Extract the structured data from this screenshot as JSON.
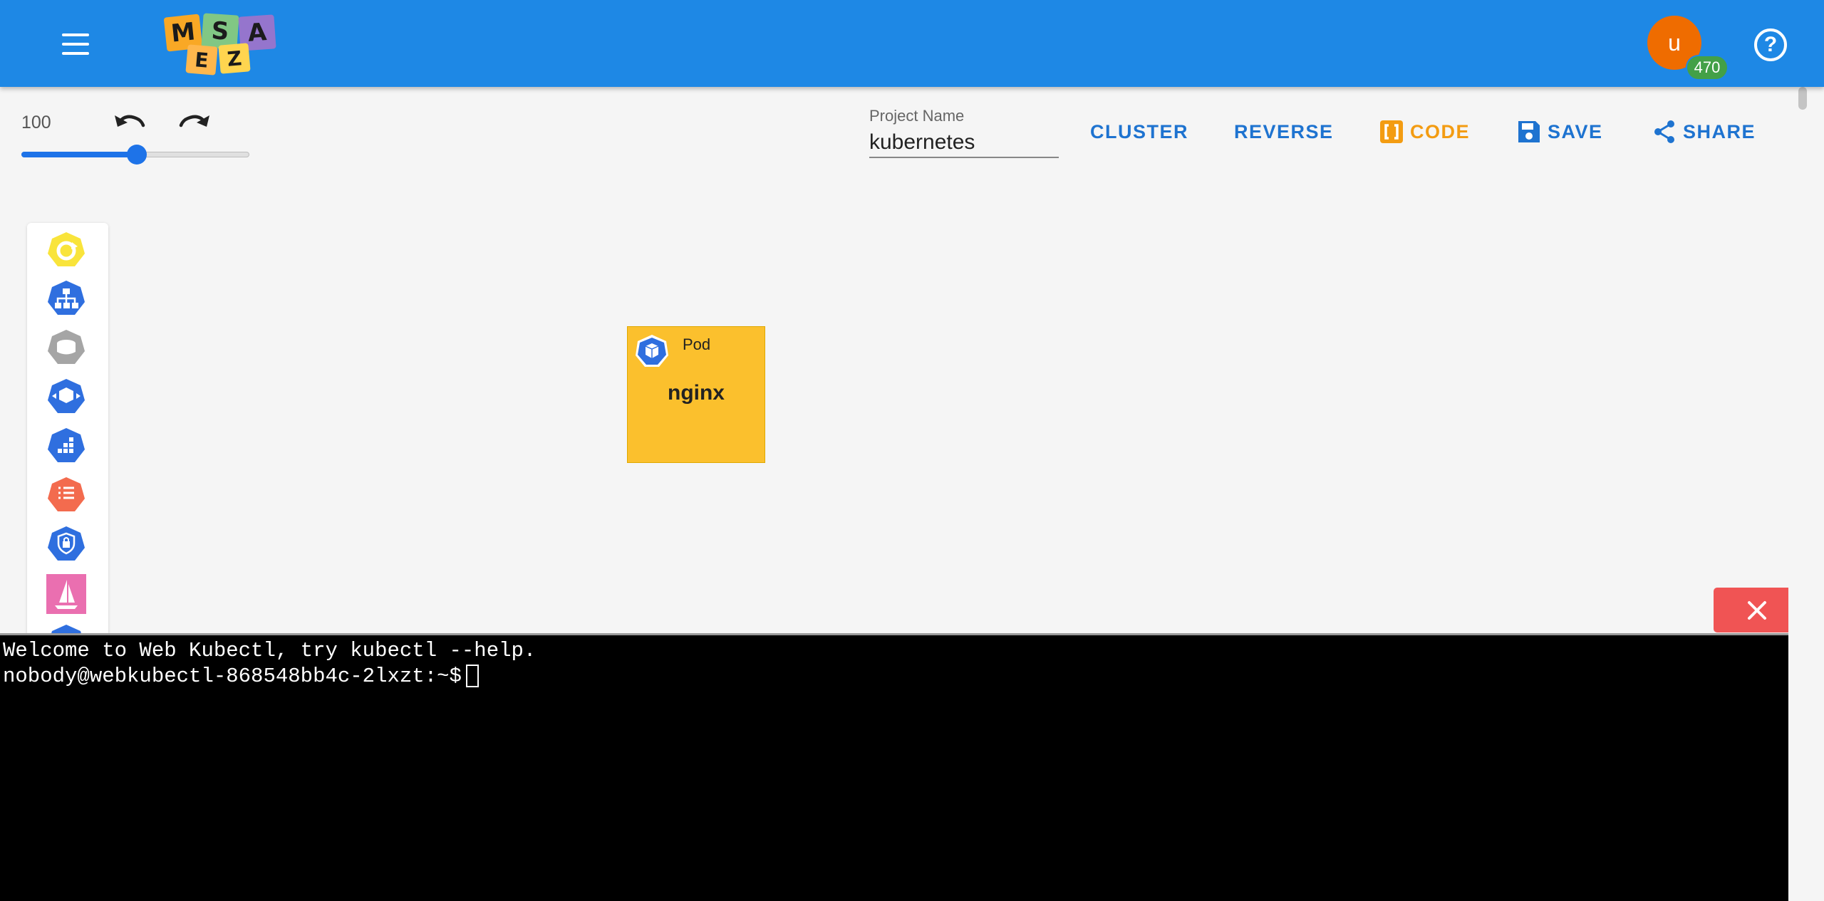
{
  "header": {
    "logo_letters": [
      "M",
      "S",
      "A",
      "E",
      "Z"
    ],
    "user_initial": "u",
    "badge_count": "470",
    "help_symbol": "?",
    "colors": {
      "bar": "#1e88e5",
      "avatar": "#ef6c00",
      "badge": "#43a047"
    }
  },
  "toolbar": {
    "zoom_value": "100",
    "zoom_fraction": 0.5,
    "project_label": "Project Name",
    "project_value": "kubernetes",
    "buttons": {
      "cluster": "CLUSTER",
      "reverse": "REVERSE",
      "code": "CODE",
      "save": "SAVE",
      "share": "SHARE"
    }
  },
  "palette": {
    "items": [
      "refresh-hexagon-icon",
      "network-hexagon-icon",
      "volume-hexagon-icon",
      "deployment-hexagon-icon",
      "grid-hexagon-icon",
      "list-hexagon-icon",
      "secret-hexagon-icon",
      "sail-icon"
    ]
  },
  "canvas": {
    "node": {
      "type": "Pod",
      "name": "nginx",
      "color": "#fbc02d"
    }
  },
  "terminal": {
    "line1": "Welcome to Web Kubectl, try kubectl --help.",
    "prompt": "nobody@webkubectl-868548bb4c-2lxzt:~$"
  }
}
